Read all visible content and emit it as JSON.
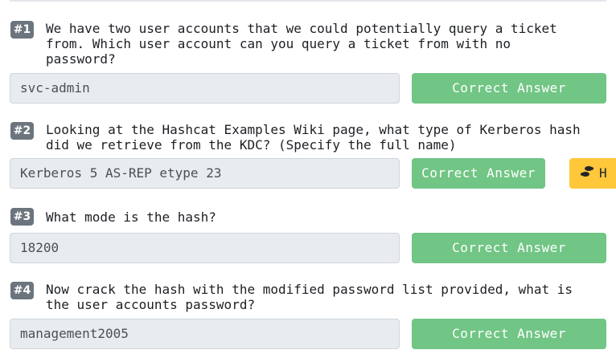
{
  "questions": [
    {
      "number": "#1",
      "text": "We have two user accounts that we could potentially query a ticket\nfrom. Which user account can you query a ticket from with no\npassword?",
      "answer": "svc-admin",
      "button": "Correct Answer"
    },
    {
      "number": "#2",
      "text": "Looking at the Hashcat Examples Wiki page, what type of Kerberos hash\ndid we retrieve from the KDC? (Specify the full name)",
      "answer": "Kerberos 5 AS-REP etype 23",
      "button": "Correct Answer",
      "hint_icon": "footprints-icon",
      "hint_label": "H"
    },
    {
      "number": "#3",
      "text": "What mode is the hash?",
      "answer": "18200",
      "button": "Correct Answer"
    },
    {
      "number": "#4",
      "text": "Now crack the hash with the modified password list provided, what is\nthe user accounts password?",
      "answer": "management2005",
      "button": "Correct Answer"
    }
  ],
  "colors": {
    "correct_button": "#71c585",
    "hint_button": "#ffc73a",
    "question_badge": "#6c757d",
    "input_background": "#e9ecef"
  }
}
